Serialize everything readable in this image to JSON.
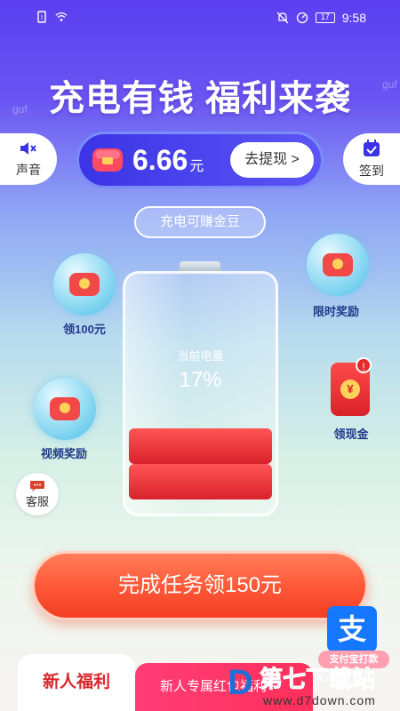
{
  "status_bar": {
    "time": "9:58",
    "battery": "17"
  },
  "headline": "充电有钱 福利来袭",
  "watermarks": [
    "guf",
    "guf"
  ],
  "sound_button": {
    "label": "声音",
    "icon": "speaker-mute-icon"
  },
  "signin_button": {
    "label": "签到",
    "icon": "calendar-check-icon"
  },
  "balance": {
    "amount": "6.66",
    "unit": "元",
    "withdraw_label": "去提现 >"
  },
  "earn_label": "充电可赚金豆",
  "rewards": {
    "left_top": "领100元",
    "left_bottom": "视频奖励",
    "right_top": "限时奖励",
    "right_mid": "领现金"
  },
  "battery": {
    "label": "当前电量",
    "percent": "17%",
    "level": 0.17
  },
  "customer_service": "客服",
  "cta_label": "完成任务领150元",
  "tabs": {
    "active": "新人福利",
    "inactive": "新人专属红包福利"
  },
  "alipay": {
    "glyph": "支",
    "tag": "支付宝打款"
  },
  "site_watermark": {
    "title": "第七下载站",
    "url": "www.d7down.com"
  },
  "colors": {
    "accent": "#5c55f5",
    "cta": "#ff5a3a",
    "battery_fill": "#e2272f"
  }
}
